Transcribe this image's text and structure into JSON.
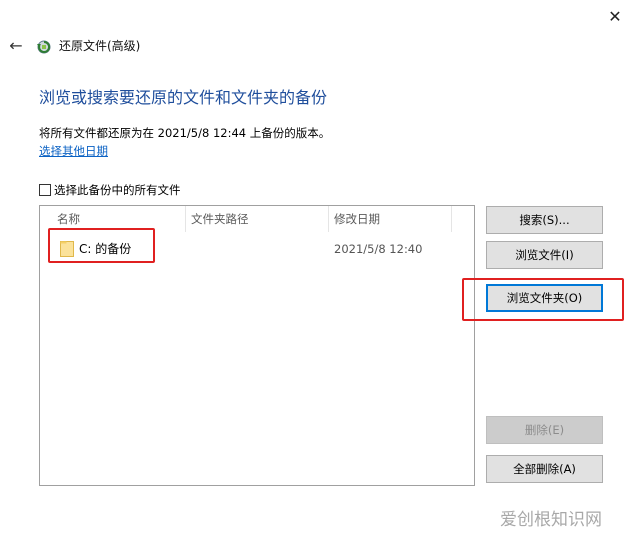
{
  "window": {
    "title": "还原文件(高级)",
    "close_glyph": "✕",
    "back_glyph": "←"
  },
  "main": {
    "heading": "浏览或搜索要还原的文件和文件夹的备份",
    "info_text": "将所有文件都还原为在 2021/5/8 12:44 上备份的版本。",
    "choose_date_link": "选择其他日期",
    "select_all_label": "选择此备份中的所有文件",
    "select_all_checked": false
  },
  "file_list": {
    "columns": [
      "名称",
      "文件夹路径",
      "修改日期"
    ],
    "rows": [
      {
        "name": "C: 的备份",
        "path": "",
        "modified": "2021/5/8 12:40",
        "icon": "folder-icon"
      }
    ]
  },
  "buttons": {
    "search": "搜索(S)...",
    "browse_files": "浏览文件(I)",
    "browse_folders": "浏览文件夹(O)",
    "remove": "删除(E)",
    "remove_all": "全部删除(A)"
  },
  "watermark": "爱创根知识网",
  "colors": {
    "heading": "#1f4e9c",
    "link": "#0b62c4",
    "highlight": "#e02020",
    "button_bg": "#e1e1e1",
    "focus_border": "#0078d7"
  }
}
